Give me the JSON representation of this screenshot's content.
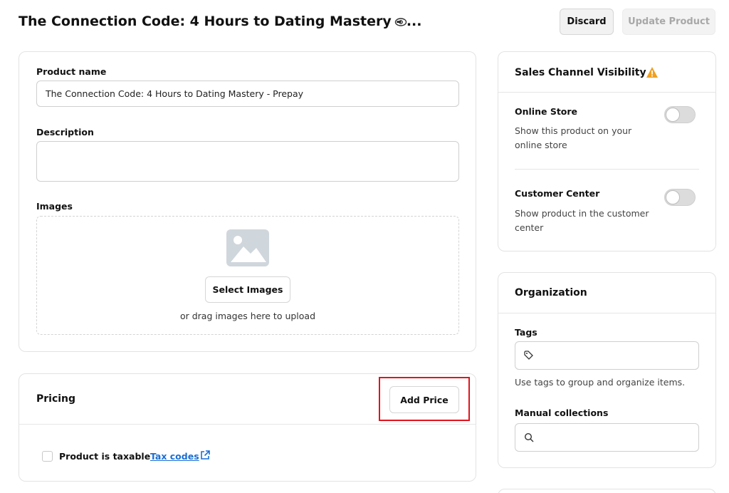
{
  "header": {
    "title": "The Connection Code: 4 Hours to Dating Mastery - ...",
    "discard_label": "Discard",
    "update_label": "Update Product"
  },
  "product": {
    "name_label": "Product name",
    "name_value": "The Connection Code: 4 Hours to Dating Mastery - Prepay",
    "description_label": "Description",
    "description_value": "",
    "images_label": "Images",
    "select_images_label": "Select Images",
    "drag_text": "or drag images here to upload"
  },
  "pricing": {
    "title": "Pricing",
    "add_price_label": "Add Price",
    "taxable_label": "Product is taxable",
    "taxable_checked": false,
    "tax_codes_link": "Tax codes"
  },
  "sales_channel": {
    "title": "Sales Channel Visibility",
    "channels": [
      {
        "title": "Online Store",
        "description": "Show this product on your online store",
        "enabled": false
      },
      {
        "title": "Customer Center",
        "description": "Show product in the customer center",
        "enabled": false
      }
    ]
  },
  "organization": {
    "title": "Organization",
    "tags_label": "Tags",
    "tags_value": "",
    "tags_helper": "Use tags to group and organize items.",
    "collections_label": "Manual collections",
    "collections_value": ""
  },
  "colors": {
    "accent_link": "#1a6fd6",
    "warning": "#f0a020",
    "highlight": "#e0141e",
    "toggle_off": "#dcdcdc"
  }
}
